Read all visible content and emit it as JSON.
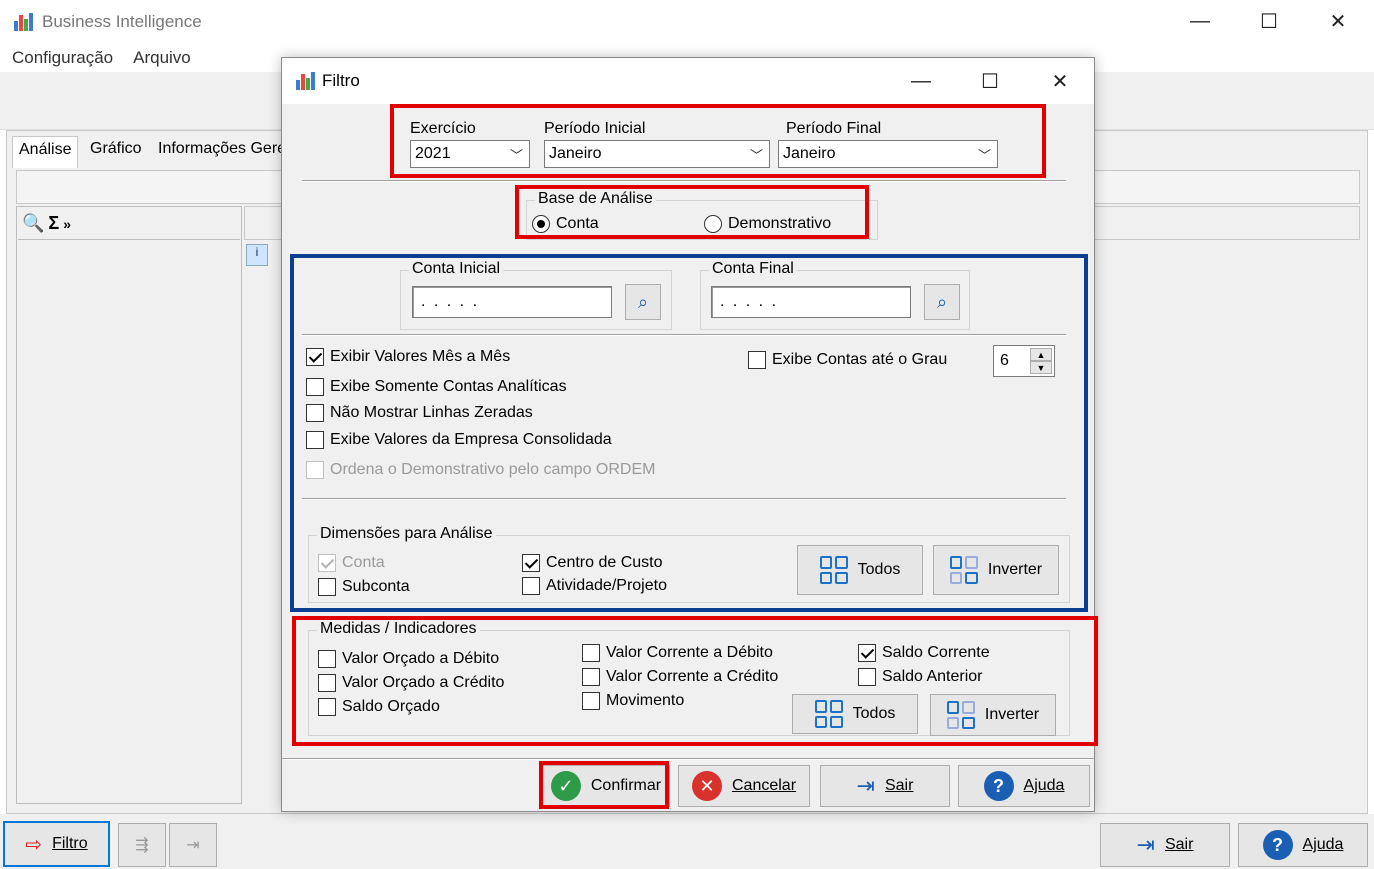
{
  "app": {
    "title": "Business Intelligence",
    "menu": [
      "Configuração",
      "Arquivo"
    ],
    "tabs": [
      "Análise",
      "Gráfico",
      "Informações Gere"
    ],
    "bottom": {
      "filtro": "Filtro",
      "sair": "Sair",
      "ajuda": "Ajuda"
    }
  },
  "dialog": {
    "title": "Filtro",
    "exercicio": {
      "label": "Exercício",
      "value": "2021"
    },
    "periodo_inicial": {
      "label": "Período Inicial",
      "value": "Janeiro"
    },
    "periodo_final": {
      "label": "Período Final",
      "value": "Janeiro"
    },
    "base": {
      "title": "Base de Análise",
      "options": [
        "Conta",
        "Demonstrativo"
      ],
      "selected": "Conta"
    },
    "conta_inicial": {
      "label": "Conta Inicial",
      "value": ". . . . ."
    },
    "conta_final": {
      "label": "Conta Final",
      "value": ". . . . ."
    },
    "options": [
      {
        "label": "Exibir Valores Mês a Mês",
        "checked": true
      },
      {
        "label": "Exibe Somente Contas Analíticas",
        "checked": false
      },
      {
        "label": "Não Mostrar Linhas Zeradas",
        "checked": false
      },
      {
        "label": "Exibe Valores da Empresa Consolidada",
        "checked": false
      },
      {
        "label": "Ordena o Demonstrativo pelo campo ORDEM",
        "checked": false,
        "disabled": true
      }
    ],
    "grau": {
      "label": "Exibe Contas até o Grau",
      "checked": false,
      "value": "6"
    },
    "dimensoes": {
      "title": "Dimensões para Análise",
      "items": [
        {
          "label": "Conta",
          "checked": true,
          "disabled": true
        },
        {
          "label": "Subconta",
          "checked": false
        },
        {
          "label": "Centro de Custo",
          "checked": true
        },
        {
          "label": "Atividade/Projeto",
          "checked": false
        }
      ],
      "todos": "Todos",
      "inverter": "Inverter"
    },
    "medidas": {
      "title": "Medidas / Indicadores",
      "items": [
        {
          "label": "Valor Orçado a Débito",
          "checked": false
        },
        {
          "label": "Valor Orçado a Crédito",
          "checked": false
        },
        {
          "label": "Saldo Orçado",
          "checked": false
        },
        {
          "label": "Valor Corrente a Débito",
          "checked": false
        },
        {
          "label": "Valor Corrente a Crédito",
          "checked": false
        },
        {
          "label": "Movimento",
          "checked": false
        },
        {
          "label": "Saldo Corrente",
          "checked": true
        },
        {
          "label": "Saldo Anterior",
          "checked": false
        }
      ],
      "todos": "Todos",
      "inverter": "Inverter"
    },
    "buttons": {
      "confirmar": "Confirmar",
      "cancelar": "Cancelar",
      "sair": "Sair",
      "ajuda": "Ajuda"
    }
  },
  "colors": {
    "highlight_red": "#e00000",
    "highlight_blue": "#0b3d91",
    "accent": "#0078d7",
    "confirm_green": "#2e9b48",
    "cancel_red": "#d9312b",
    "help_blue": "#1a5fb4"
  }
}
